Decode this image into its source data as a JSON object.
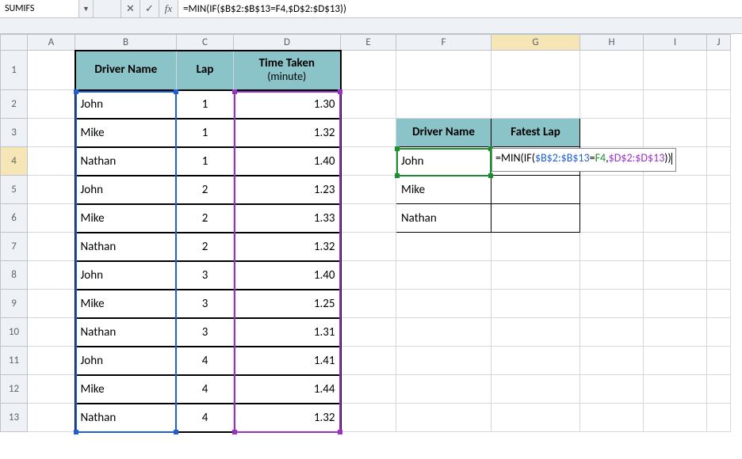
{
  "name_box": "SUMIFS",
  "formula": "=MIN(IF($B$2:$B$13=F4,$D$2:$D$13))",
  "icons": {
    "cancel": "✕",
    "enter": "✓",
    "fx": "fx",
    "dropdown": "▼"
  },
  "columns": [
    "A",
    "B",
    "C",
    "D",
    "E",
    "F",
    "G",
    "H",
    "I",
    "J"
  ],
  "rows": [
    "1",
    "2",
    "3",
    "4",
    "5",
    "6",
    "7",
    "8",
    "9",
    "10",
    "11",
    "12",
    "13"
  ],
  "active_col": "G",
  "active_row": "4",
  "headers": {
    "driver": "Driver Name",
    "lap": "Lap",
    "time_main": "Time Taken",
    "time_sub": "(minute)"
  },
  "data": [
    {
      "driver": "John",
      "lap": "1",
      "time": "1.30"
    },
    {
      "driver": "Mike",
      "lap": "1",
      "time": "1.32"
    },
    {
      "driver": "Nathan",
      "lap": "1",
      "time": "1.40"
    },
    {
      "driver": "John",
      "lap": "2",
      "time": "1.23"
    },
    {
      "driver": "Mike",
      "lap": "2",
      "time": "1.33"
    },
    {
      "driver": "Nathan",
      "lap": "2",
      "time": "1.32"
    },
    {
      "driver": "John",
      "lap": "3",
      "time": "1.40"
    },
    {
      "driver": "Mike",
      "lap": "3",
      "time": "1.25"
    },
    {
      "driver": "Nathan",
      "lap": "3",
      "time": "1.31"
    },
    {
      "driver": "John",
      "lap": "4",
      "time": "1.41"
    },
    {
      "driver": "Mike",
      "lap": "4",
      "time": "1.44"
    },
    {
      "driver": "Nathan",
      "lap": "4",
      "time": "1.32"
    }
  ],
  "summary_headers": {
    "driver": "Driver Name",
    "best": "Fatest Lap"
  },
  "summary": [
    {
      "driver": "John"
    },
    {
      "driver": "Mike"
    },
    {
      "driver": "Nathan"
    }
  ],
  "editing": {
    "pre": "=MIN(IF(",
    "r1": "$B$2:$B$13",
    "mid1": "=",
    "r2": "F4",
    "mid2": ",",
    "r3": "$D$2:$D$13",
    "post": "))"
  }
}
